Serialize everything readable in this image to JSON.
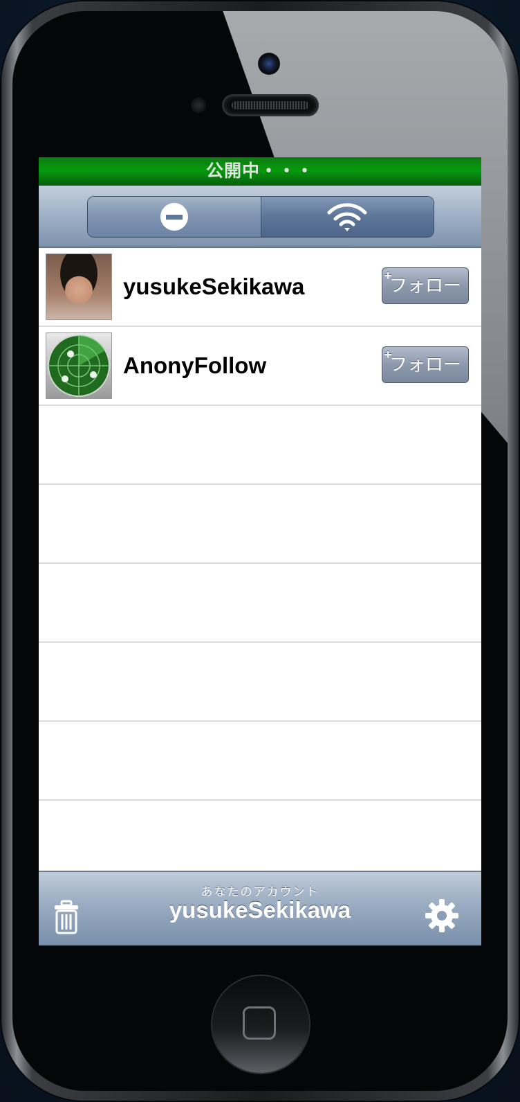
{
  "status_bar": {
    "text": "公開中・・・",
    "color": "#079a0e"
  },
  "toolbar": {
    "segments": [
      {
        "icon": "minus-circle-icon",
        "selected": false
      },
      {
        "icon": "wifi-icon",
        "selected": true
      }
    ]
  },
  "users": [
    {
      "name": "yusukeSekikawa",
      "avatar": "person-photo",
      "follow_label": "フォロー",
      "follow_plus": "+"
    },
    {
      "name": "AnonyFollow",
      "avatar": "radar-icon",
      "follow_label": "フォロー",
      "follow_plus": "+"
    }
  ],
  "bottom_bar": {
    "caption": "あなたのアカウント",
    "account_name": "yusukeSekikawa",
    "left_icon": "trash-icon",
    "right_icon": "gear-icon"
  }
}
